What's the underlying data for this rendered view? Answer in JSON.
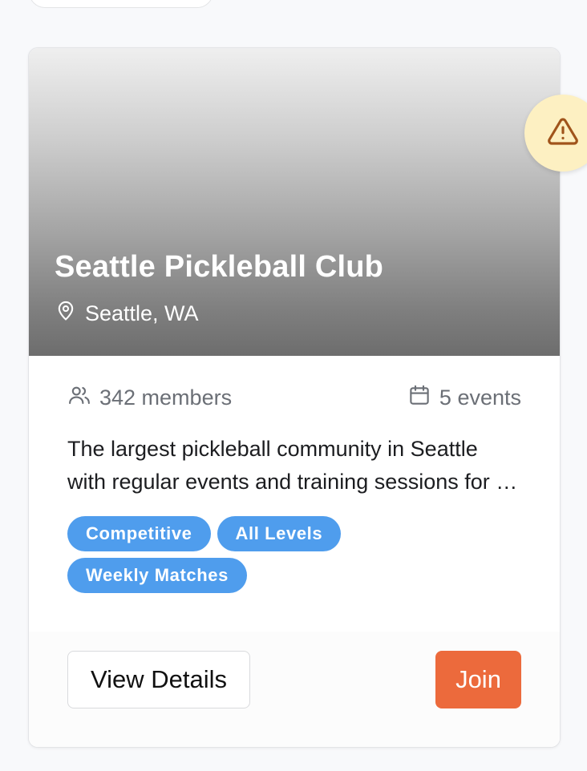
{
  "card": {
    "title": "Seattle Pickleball Club",
    "location": "Seattle, WA",
    "members": "342 members",
    "events": "5 events",
    "description": "The largest pickleball community in Seattle with regular events and training sessions for all skill levels.",
    "tags": [
      "Competitive",
      "All Levels",
      "Weekly Matches"
    ],
    "details_label": "View Details",
    "join_label": "Join"
  },
  "icons": {
    "location": "map-pin-icon",
    "members": "users-icon",
    "events": "calendar-icon",
    "warning": "alert-triangle-icon"
  },
  "colors": {
    "tag": "#4f9ded",
    "join": "#ec6a3c",
    "warning_bg": "#fdf0c2",
    "warning_icon": "#a0541b"
  }
}
